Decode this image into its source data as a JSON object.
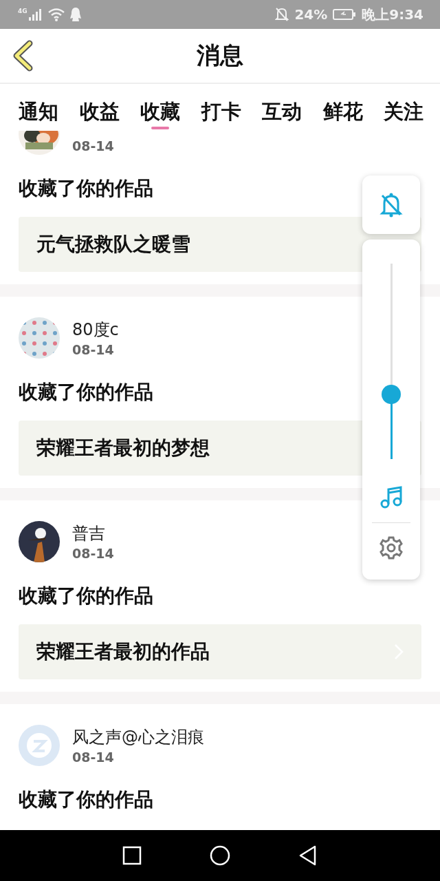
{
  "status_bar": {
    "network": "4G",
    "battery": "24%",
    "time": "晚上9:34"
  },
  "header": {
    "title": "消息"
  },
  "tabs": [
    {
      "label": "通知",
      "selected": false
    },
    {
      "label": "收益",
      "selected": false
    },
    {
      "label": "收藏",
      "selected": true
    },
    {
      "label": "打卡",
      "selected": false
    },
    {
      "label": "互动",
      "selected": false
    },
    {
      "label": "鲜花",
      "selected": false
    },
    {
      "label": "关注",
      "selected": false
    }
  ],
  "items": [
    {
      "date": "08-14",
      "action": "收藏了你的作品",
      "work": "元气拯救队之暖雪",
      "chevron": false
    },
    {
      "name": "80度c",
      "date": "08-14",
      "action": "收藏了你的作品",
      "work": "荣耀王者最初的梦想",
      "chevron": false
    },
    {
      "name": "普吉",
      "date": "08-14",
      "action": "收藏了你的作品",
      "work": "荣耀王者最初的作品",
      "chevron": true
    },
    {
      "name": "风之声@心之泪痕",
      "date": "08-14",
      "action": "收藏了你的作品"
    }
  ],
  "volume_panel": {
    "level": 0.33
  }
}
